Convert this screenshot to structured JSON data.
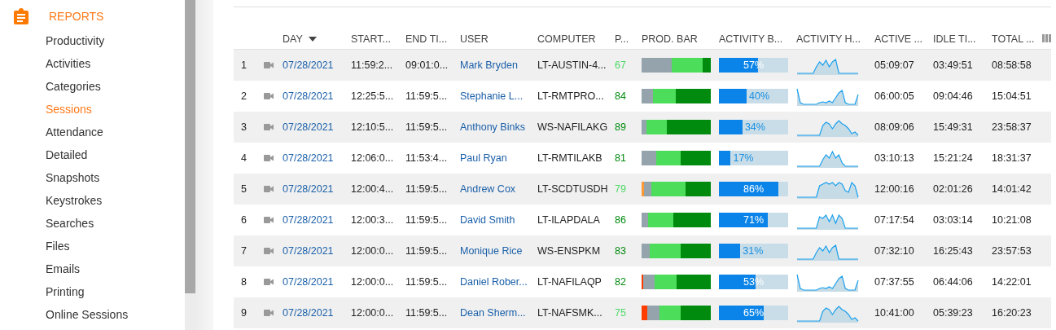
{
  "sidebar": {
    "section": "REPORTS",
    "items": [
      {
        "label": "Productivity",
        "selected": false
      },
      {
        "label": "Activities",
        "selected": false
      },
      {
        "label": "Categories",
        "selected": false
      },
      {
        "label": "Sessions",
        "selected": true
      },
      {
        "label": "Attendance",
        "selected": false
      },
      {
        "label": "Detailed",
        "selected": false
      },
      {
        "label": "Snapshots",
        "selected": false
      },
      {
        "label": "Keystrokes",
        "selected": false
      },
      {
        "label": "Searches",
        "selected": false
      },
      {
        "label": "Files",
        "selected": false
      },
      {
        "label": "Emails",
        "selected": false
      },
      {
        "label": "Printing",
        "selected": false
      },
      {
        "label": "Online Sessions",
        "selected": false
      }
    ]
  },
  "table": {
    "columns": [
      {
        "label": "DAY",
        "sorted": true
      },
      {
        "label": "START...",
        "sorted": false
      },
      {
        "label": "END TI...",
        "sorted": false
      },
      {
        "label": "USER",
        "sorted": false
      },
      {
        "label": "COMPUTER",
        "sorted": false
      },
      {
        "label": "P...",
        "sorted": false
      },
      {
        "label": "PROD. BAR",
        "sorted": false
      },
      {
        "label": "ACTIVITY B...",
        "sorted": false
      },
      {
        "label": "ACTIVITY H...",
        "sorted": false
      },
      {
        "label": "ACTIVE ...",
        "sorted": false
      },
      {
        "label": "IDLE TI...",
        "sorted": false
      },
      {
        "label": "TOTAL ...",
        "sorted": false
      }
    ],
    "rows": [
      {
        "num": "1",
        "day": "07/28/2021",
        "start": "11:59:2...",
        "end": "09:01:0...",
        "user": "Mark Bryden",
        "computer": "LT-AUSTIN-4...",
        "score": {
          "text": "67",
          "color": "#4cd964"
        },
        "prod": [
          {
            "color": "#94a3ac"
          },
          {
            "color": "#4cde5a"
          },
          {
            "color": "#008a0e"
          }
        ],
        "activity": {
          "level": 0.57,
          "text": "57%"
        },
        "active": "05:09:07",
        "idle": "03:49:51",
        "total": "08:58:58"
      },
      {
        "num": "2",
        "day": "07/28/2021",
        "start": "12:25:5...",
        "end": "11:59:5...",
        "user": "Stephanie L...",
        "computer": "LT-RMTPRO...",
        "score": {
          "text": "84",
          "color": "#008a0e"
        },
        "prod": [
          {
            "color": "#94a3ac"
          },
          {
            "color": "#4cde5a"
          },
          {
            "color": "#008a0e"
          }
        ],
        "activity": {
          "level": 0.4,
          "text": "40%"
        },
        "active": "06:00:05",
        "idle": "09:04:46",
        "total": "15:04:51"
      },
      {
        "num": "3",
        "day": "07/28/2021",
        "start": "12:10:5...",
        "end": "11:59:5...",
        "user": "Anthony Binks",
        "computer": "WS-NAFILAKG",
        "score": {
          "text": "89",
          "color": "#008a0e"
        },
        "prod": [
          {
            "color": "#94a3ac"
          },
          {
            "color": "#4cde5a"
          },
          {
            "color": "#008a0e"
          }
        ],
        "activity": {
          "level": 0.34,
          "text": "34%"
        },
        "active": "08:09:06",
        "idle": "15:49:31",
        "total": "23:58:37"
      },
      {
        "num": "4",
        "day": "07/28/2021",
        "start": "12:06:0...",
        "end": "11:53:4...",
        "user": "Paul Ryan",
        "computer": "LT-RMTILAKB",
        "score": {
          "text": "81",
          "color": "#008a0e"
        },
        "prod": [
          {
            "color": "#94a3ac"
          },
          {
            "color": "#4cde5a"
          },
          {
            "color": "#008a0e"
          }
        ],
        "activity": {
          "level": 0.17,
          "text": "17%"
        },
        "active": "03:10:13",
        "idle": "15:21:24",
        "total": "18:31:37"
      },
      {
        "num": "5",
        "day": "07/28/2021",
        "start": "12:00:4...",
        "end": "11:59:5...",
        "user": "Andrew Cox",
        "computer": "LT-SCDTUSDH",
        "score": {
          "text": "79",
          "color": "#4cd964"
        },
        "prod": [
          {
            "color": "#ff9933"
          },
          {
            "color": "#94a3ac"
          },
          {
            "color": "#4cde5a"
          },
          {
            "color": "#008a0e"
          }
        ],
        "activity": {
          "level": 0.86,
          "text": "86%"
        },
        "active": "12:00:16",
        "idle": "02:01:26",
        "total": "14:01:42"
      },
      {
        "num": "6",
        "day": "07/28/2021",
        "start": "12:00:3...",
        "end": "11:59:5...",
        "user": "David Smith",
        "computer": "LT-ILAPDALA",
        "score": {
          "text": "86",
          "color": "#008a0e"
        },
        "prod": [
          {
            "color": "#94a3ac"
          },
          {
            "color": "#4cde5a"
          },
          {
            "color": "#008a0e"
          }
        ],
        "activity": {
          "level": 0.71,
          "text": "71%"
        },
        "active": "07:17:54",
        "idle": "03:03:14",
        "total": "10:21:08"
      },
      {
        "num": "7",
        "day": "07/28/2021",
        "start": "12:00:0...",
        "end": "11:59:5...",
        "user": "Monique Rice",
        "computer": "WS-ENSPKM",
        "score": {
          "text": "83",
          "color": "#008a0e"
        },
        "prod": [
          {
            "color": "#94a3ac"
          },
          {
            "color": "#4cde5a"
          },
          {
            "color": "#008a0e"
          }
        ],
        "activity": {
          "level": 0.31,
          "text": "31%"
        },
        "active": "07:32:10",
        "idle": "16:25:43",
        "total": "23:57:53"
      },
      {
        "num": "8",
        "day": "07/28/2021",
        "start": "12:00:0...",
        "end": "11:59:5...",
        "user": "Daniel Rober...",
        "computer": "LT-NAFILAQP",
        "score": {
          "text": "82",
          "color": "#008a0e"
        },
        "prod": [
          {
            "color": "#ff3d00"
          },
          {
            "color": "#94a3ac"
          },
          {
            "color": "#4cde5a"
          },
          {
            "color": "#008a0e"
          }
        ],
        "activity": {
          "level": 0.53,
          "text": "53%"
        },
        "active": "07:37:55",
        "idle": "06:44:06",
        "total": "14:22:01"
      },
      {
        "num": "9",
        "day": "07/28/2021",
        "start": "12:00:0...",
        "end": "11:59:5...",
        "user": "Dean Sherm...",
        "computer": "LT-NAFSMK...",
        "score": {
          "text": "75",
          "color": "#4cd964"
        },
        "prod": [
          {
            "color": "#ff3d00"
          },
          {
            "color": "#94a3ac"
          },
          {
            "color": "#4cde5a"
          },
          {
            "color": "#008a0e"
          }
        ],
        "activity": {
          "level": 0.65,
          "text": "65%"
        },
        "active": "10:41:00",
        "idle": "05:39:23",
        "total": "16:20:23"
      }
    ]
  }
}
